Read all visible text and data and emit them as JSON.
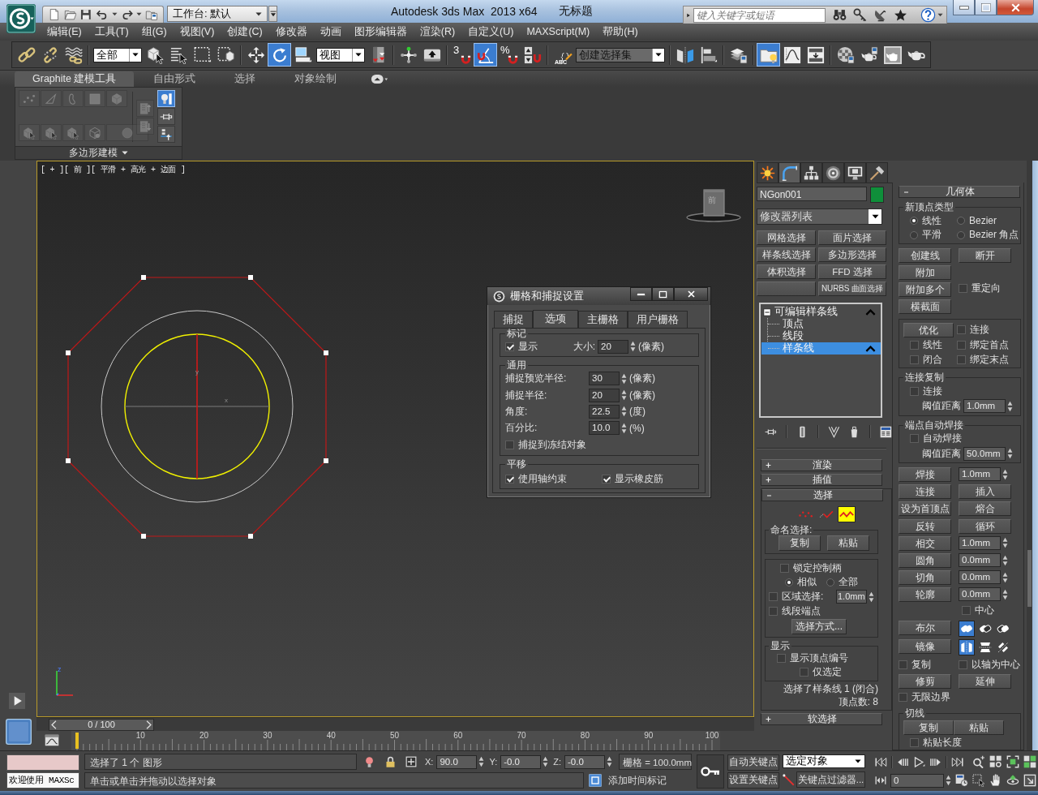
{
  "title_bar": {
    "workspace": "工作台: 默认",
    "app_title": "Autodesk 3ds Max  2013 x64",
    "document_title": "无标题",
    "search": {
      "placeholder": "键入关键字或短语"
    }
  },
  "menu_bar": [
    "编辑(E)",
    "工具(T)",
    "组(G)",
    "视图(V)",
    "创建(C)",
    "修改器",
    "动画",
    "图形编辑器",
    "渲染(R)",
    "自定义(U)",
    "MAXScript(M)",
    "帮助(H)"
  ],
  "main_toolbar": [
    [
      {
        "kind": "link",
        "on": false
      },
      {
        "kind": "unlink",
        "on": false
      },
      {
        "kind": "bind",
        "on": false
      }
    ],
    [
      {
        "kind": "dropdown",
        "value": "全部"
      },
      {
        "kind": "select",
        "on": false
      },
      {
        "kind": "select-by-name",
        "on": false
      },
      {
        "kind": "region",
        "on": false
      },
      {
        "kind": "crossing",
        "on": false
      }
    ],
    [
      {
        "kind": "move",
        "on": false
      },
      {
        "kind": "rotate",
        "on": true
      },
      {
        "kind": "scale",
        "on": false
      },
      {
        "kind": "dropdown",
        "value": "视图"
      },
      {
        "kind": "pivot",
        "on": false
      }
    ],
    [
      {
        "kind": "manipulate",
        "on": false
      },
      {
        "kind": "keyboard",
        "on": false
      }
    ],
    [
      {
        "kind": "snap",
        "glyph": "3",
        "on": false
      },
      {
        "kind": "angle-snap",
        "on": true
      },
      {
        "kind": "snap",
        "glyph": "%",
        "on": false
      },
      {
        "kind": "spinner-snap",
        "on": false
      }
    ],
    [
      {
        "kind": "named-sets",
        "glyph": "ABC",
        "on": false
      },
      {
        "kind": "dropdown",
        "value": "创建选择集"
      }
    ],
    [
      {
        "kind": "mirror",
        "on": false
      },
      {
        "kind": "align",
        "on": false
      }
    ],
    [
      {
        "kind": "layers",
        "on": false
      }
    ],
    [
      {
        "kind": "explorer",
        "on": true
      },
      {
        "kind": "curves",
        "on": false
      },
      {
        "kind": "schematic",
        "on": false
      }
    ],
    [
      {
        "kind": "material",
        "on": false
      },
      {
        "kind": "render-setup",
        "on": false
      },
      {
        "kind": "frame-window",
        "on": false
      },
      {
        "kind": "render",
        "on": false
      }
    ]
  ],
  "ribbon": {
    "tabs": [
      {
        "label": "Graphite 建模工具",
        "selected": true
      },
      {
        "label": "自由形式",
        "selected": false
      },
      {
        "label": "选择",
        "selected": false
      },
      {
        "label": "对象绘制",
        "selected": false
      }
    ],
    "tool_groups": [
      [
        {
          "kind": "vertex",
          "disabled": true,
          "on": false
        },
        {
          "kind": "edge",
          "disabled": true,
          "on": false
        },
        {
          "kind": "border",
          "disabled": true,
          "on": false
        },
        {
          "kind": "polygon",
          "disabled": true,
          "on": false
        },
        {
          "kind": "element",
          "disabled": true,
          "on": false
        },
        {
          "kind": "cube-cursor",
          "disabled": true,
          "on": false
        },
        {
          "kind": "cube-cursor",
          "disabled": true,
          "on": false
        },
        {
          "kind": "cube-cursor",
          "disabled": true,
          "on": false
        },
        {
          "kind": "cage",
          "disabled": true,
          "on": false
        },
        {
          "kind": "round",
          "disabled": true,
          "on": false
        }
      ],
      [
        {
          "kind": "up",
          "disabled": true,
          "on": false
        },
        {
          "kind": "down",
          "disabled": true,
          "on": false
        }
      ],
      [
        {
          "kind": "bulb-bar",
          "disabled": false,
          "on": true
        },
        {
          "kind": "pin",
          "disabled": false,
          "on": false
        },
        {
          "kind": "stack-up",
          "disabled": false,
          "on": false
        }
      ]
    ],
    "panel_label": "多边形建模"
  },
  "viewport": {
    "label": "[ + ][ 前 ][ 平滑 + 高光 + 边面 ]",
    "active": true,
    "view_cube_label": "前",
    "gizmo_labels": [
      "y",
      "x"
    ],
    "tripod_labels": [
      "z"
    ]
  },
  "snap_dialog": {
    "title": "栅格和捕捉设置",
    "tabs": [
      {
        "label": "捕捉",
        "selected": false
      },
      {
        "label": "选项",
        "selected": true
      },
      {
        "label": "主栅格",
        "selected": false
      },
      {
        "label": "用户栅格",
        "selected": false
      }
    ],
    "groups": [
      {
        "title": "标记",
        "items": [
          {
            "kind": "checkbox",
            "label": "显示",
            "checked": true
          },
          {
            "kind": "spinner",
            "label": "大小:",
            "value": "20",
            "unit": "(像素)"
          }
        ]
      },
      {
        "title": "通用",
        "items": [
          {
            "kind": "spinner",
            "label": "捕捉预览半径:",
            "value": "30",
            "unit": "(像素)"
          },
          {
            "kind": "spinner",
            "label": "捕捉半径:",
            "value": "20",
            "unit": "(像素)"
          },
          {
            "kind": "spinner",
            "label": "角度:",
            "value": "22.5",
            "unit": "(度)"
          },
          {
            "kind": "spinner",
            "label": "百分比:",
            "value": "10.0",
            "unit": "(%)"
          },
          {
            "kind": "checkbox",
            "label": "捕捉到冻结对象",
            "checked": false
          }
        ]
      },
      {
        "title": "平移",
        "items": [
          {
            "kind": "checkbox",
            "label": "使用轴约束",
            "checked": true
          },
          {
            "kind": "checkbox",
            "label": "显示橡皮筋",
            "checked": true
          }
        ]
      }
    ]
  },
  "command_panel": {
    "tabs": [
      {
        "kind": "create",
        "selected": false
      },
      {
        "kind": "modify",
        "selected": true
      },
      {
        "kind": "hierarchy",
        "selected": false
      },
      {
        "kind": "motion",
        "selected": false
      },
      {
        "kind": "display",
        "selected": false
      },
      {
        "kind": "utilities",
        "selected": false
      }
    ],
    "object_name": "NGon001",
    "modifier_list": "修改器列表",
    "modifier_sets": [
      {
        "kind": "button",
        "label": "网格选择"
      },
      {
        "kind": "button",
        "label": "面片选择"
      },
      {
        "kind": "button",
        "label": "样条线选择"
      },
      {
        "kind": "button",
        "label": "多边形选择"
      },
      {
        "kind": "button",
        "label": "体积选择"
      },
      {
        "kind": "button",
        "label": "FFD 选择"
      },
      {
        "kind": "blank"
      },
      {
        "kind": "button",
        "label": "NURBS 曲面选择"
      }
    ],
    "stack": [
      {
        "label": "可编辑样条线",
        "expanded": true,
        "selected": false,
        "children": [
          {
            "label": "顶点",
            "selected": false
          },
          {
            "label": "线段",
            "selected": false
          },
          {
            "label": "样条线",
            "selected": true
          }
        ]
      }
    ],
    "rollouts": [
      {
        "kind": "rendering",
        "title": "渲染",
        "expanded": false
      },
      {
        "kind": "interpolation",
        "title": "插值",
        "expanded": false
      },
      {
        "kind": "selection",
        "title": "选择",
        "expanded": true,
        "levels": [
          {
            "kind": "vertex",
            "selected": false
          },
          {
            "kind": "segment",
            "selected": false
          },
          {
            "kind": "spline",
            "selected": true
          }
        ],
        "named_selection": {
          "title": "命名选择:",
          "buttons": [
            "复制",
            "粘贴"
          ]
        },
        "lock_handles": {
          "label": "锁定控制柄",
          "checked": false
        },
        "handle_mode": [
          {
            "label": "相似",
            "selected": true
          },
          {
            "label": "全部",
            "selected": false
          }
        ],
        "area_selection": {
          "label": "区域选择:",
          "checked": false,
          "value": "1.0mm"
        },
        "segment_end": {
          "label": "线段端点",
          "checked": false
        },
        "select_by": "选择方式...",
        "display": {
          "title": "显示",
          "options": [
            {
              "label": "显示顶点编号",
              "checked": false
            },
            {
              "label": "仅选定",
              "checked": false
            }
          ]
        },
        "status": [
          "选择了样条线 1 (闭合)",
          "顶点数: 8"
        ]
      },
      {
        "kind": "soft-selection",
        "title": "软选择",
        "expanded": false
      }
    ],
    "geometry": {
      "title": "几何体",
      "expanded": true,
      "sections": [
        {
          "kind": "group",
          "title": "新顶点类型",
          "rows": [
            [
              {
                "kind": "radio",
                "label": "线性",
                "selected": true
              },
              {
                "kind": "radio",
                "label": "Bezier",
                "selected": false
              }
            ],
            [
              {
                "kind": "radio",
                "label": "平滑",
                "selected": false
              },
              {
                "kind": "radio",
                "label": "Bezier 角点",
                "selected": false
              }
            ]
          ]
        },
        {
          "kind": "plain",
          "rows": [
            [
              {
                "kind": "button",
                "label": "创建线"
              },
              {
                "kind": "button",
                "label": "断开"
              }
            ],
            [
              {
                "kind": "button",
                "label": "附加"
              }
            ],
            [
              {
                "kind": "button",
                "label": "附加多个"
              },
              {
                "kind": "checkbox",
                "label": "重定向",
                "checked": false
              }
            ],
            [
              {
                "kind": "button",
                "label": "横截面"
              }
            ]
          ]
        },
        {
          "kind": "group",
          "rows": [
            [
              {
                "kind": "button",
                "label": "优化"
              },
              {
                "kind": "checkbox",
                "label": "连接",
                "checked": false
              }
            ],
            [
              {
                "kind": "checkbox",
                "label": "线性",
                "checked": false
              },
              {
                "kind": "checkbox",
                "label": "绑定首点",
                "checked": false
              }
            ],
            [
              {
                "kind": "checkbox",
                "label": "闭合",
                "checked": false
              },
              {
                "kind": "checkbox",
                "label": "绑定末点",
                "checked": false
              }
            ]
          ]
        },
        {
          "kind": "group",
          "title": "连接复制",
          "rows": [
            [
              {
                "kind": "checkbox",
                "label": "连接",
                "checked": false
              }
            ],
            [
              {
                "kind": "spinner",
                "label": "阈值距离",
                "value": "1.0mm"
              }
            ]
          ]
        },
        {
          "kind": "group",
          "title": "端点自动焊接",
          "rows": [
            [
              {
                "kind": "checkbox",
                "label": "自动焊接",
                "checked": false
              }
            ],
            [
              {
                "kind": "spinner",
                "label": "阈值距离",
                "value": "50.0mm"
              }
            ]
          ]
        },
        {
          "kind": "plain",
          "rows": [
            [
              {
                "kind": "button",
                "label": "焊接"
              },
              {
                "kind": "spinner",
                "value": "1.0mm"
              }
            ],
            [
              {
                "kind": "button",
                "label": "连接"
              },
              {
                "kind": "button",
                "label": "插入"
              }
            ],
            [
              {
                "kind": "button",
                "label": "设为首顶点"
              },
              {
                "kind": "button",
                "label": "熔合"
              }
            ],
            [
              {
                "kind": "button",
                "label": "反转"
              },
              {
                "kind": "button",
                "label": "循环"
              }
            ],
            [
              {
                "kind": "button",
                "label": "相交"
              },
              {
                "kind": "spinner",
                "value": "1.0mm"
              }
            ],
            [
              {
                "kind": "button",
                "label": "圆角"
              },
              {
                "kind": "spinner",
                "value": "0.0mm"
              }
            ],
            [
              {
                "kind": "button",
                "label": "切角"
              },
              {
                "kind": "spinner",
                "value": "0.0mm"
              }
            ],
            [
              {
                "kind": "button",
                "label": "轮廓"
              },
              {
                "kind": "spinner",
                "value": "0.0mm",
                "option": {
                  "label": "中心",
                  "checked": false
                }
              }
            ],
            [
              {
                "kind": "button",
                "label": "布尔"
              },
              {
                "kind": "toggles",
                "items": [
                  {
                    "kind": "union",
                    "selected": true
                  },
                  {
                    "kind": "subtract",
                    "selected": false
                  },
                  {
                    "kind": "intersect",
                    "selected": false
                  }
                ]
              }
            ],
            [
              {
                "kind": "button",
                "label": "镜像"
              },
              {
                "kind": "toggles",
                "items": [
                  {
                    "kind": "mirror-h",
                    "selected": true
                  },
                  {
                    "kind": "mirror-v",
                    "selected": false
                  },
                  {
                    "kind": "mirror-both",
                    "selected": false
                  }
                ]
              }
            ],
            [
              {
                "kind": "checkbox",
                "label": "复制",
                "checked": false
              },
              {
                "kind": "checkbox",
                "label": "以轴为中心",
                "checked": false
              }
            ],
            [
              {
                "kind": "button",
                "label": "修剪"
              },
              {
                "kind": "button",
                "label": "延伸"
              }
            ],
            [
              {
                "kind": "checkbox",
                "label": "无限边界",
                "checked": false
              }
            ]
          ]
        },
        {
          "kind": "group",
          "title": "切线",
          "rows": [
            [
              {
                "kind": "button",
                "label": "复制"
              },
              {
                "kind": "button",
                "label": "粘贴"
              }
            ],
            [
              {
                "kind": "checkbox",
                "label": "粘贴长度",
                "checked": false
              }
            ]
          ]
        }
      ]
    }
  },
  "time_slider": {
    "label": "0 / 100",
    "level": 0
  },
  "track_bar": {
    "ticks": [
      "10",
      "20",
      "30",
      "40",
      "50",
      "60",
      "70",
      "80",
      "90",
      "100"
    ]
  },
  "status_bar": {
    "listener": "欢迎使用 MAXSc",
    "prompt": "选择了 1 个 图形",
    "hint": "单击或单击并拖动以选择对象",
    "coordinates": [
      {
        "axis": "X:",
        "value": "90.0"
      },
      {
        "axis": "Y:",
        "value": "-0.0"
      },
      {
        "axis": "Z:",
        "value": "-0.0"
      }
    ],
    "grid": "栅格 = 100.0mm",
    "time_tag": "添加时间标记",
    "auto_key": "自动关键点",
    "set_key": "设置关键点",
    "key_set": "选定对象",
    "key_filters": "关键点过滤器...",
    "frame": "0"
  }
}
